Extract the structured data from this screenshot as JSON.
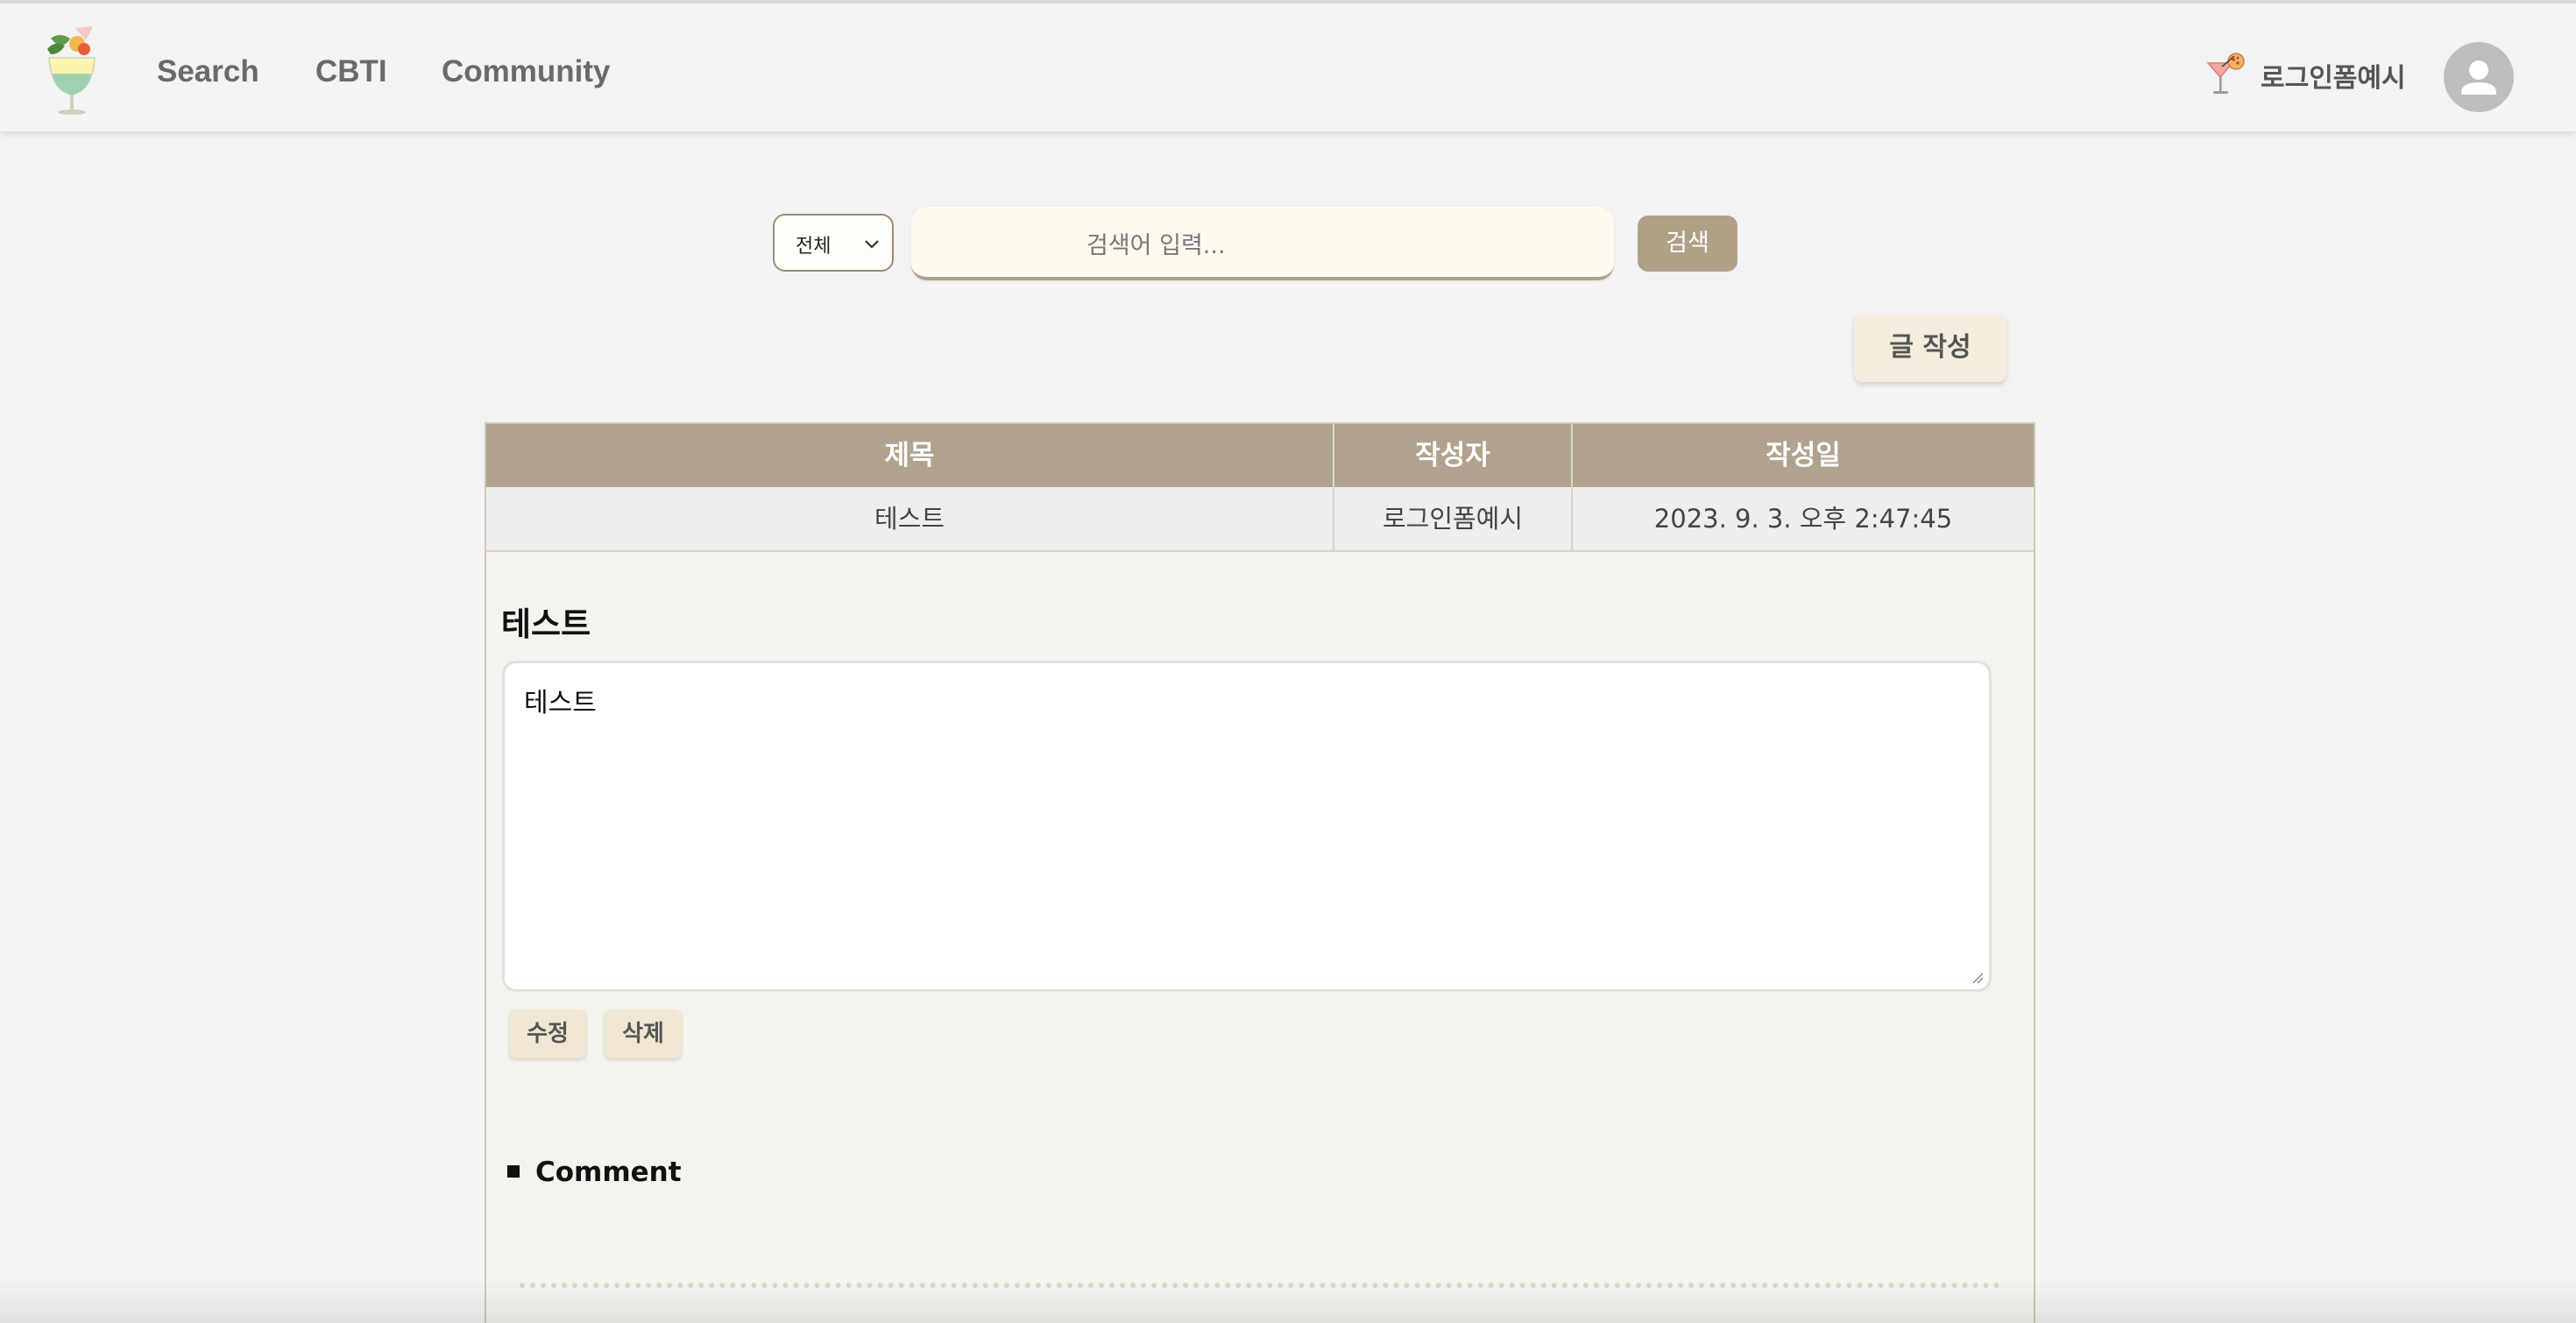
{
  "header": {
    "nav": {
      "search": "Search",
      "cbti": "CBTI",
      "community": "Community"
    },
    "user_name": "로그인폼예시"
  },
  "search": {
    "filter_selected": "전체",
    "placeholder": "검색어 입력...",
    "button_label": "검색"
  },
  "write_button_label": "글 작성",
  "board": {
    "columns": [
      "제목",
      "작성자",
      "작성일"
    ],
    "rows": [
      {
        "title": "테스트",
        "author": "로그인폼예시",
        "date": "2023. 9. 3. 오후 2:47:45"
      }
    ]
  },
  "post": {
    "title": "테스트",
    "body": "테스트",
    "edit_label": "수정",
    "delete_label": "삭제"
  },
  "comments": {
    "heading": "Comment"
  },
  "colors": {
    "accent": "#b0a085",
    "header_bg": "#f3f3f3",
    "table_header": "#b0a28d"
  }
}
